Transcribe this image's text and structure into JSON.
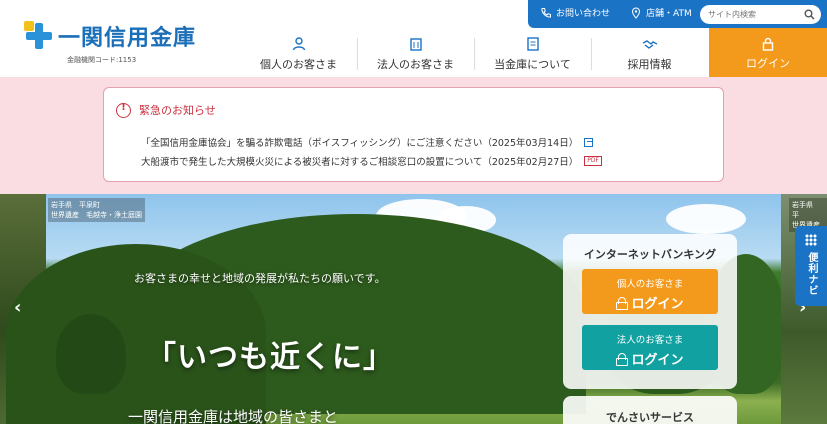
{
  "header": {
    "logo_name": "一関信用金庫",
    "bank_code": "金融機関コード:1153",
    "topbar": {
      "contact": "お問い合わせ",
      "branches": "店舗・ATM",
      "search_placeholder": "サイト内検索"
    },
    "nav": [
      {
        "label": "個人のお客さま",
        "icon": "person-icon"
      },
      {
        "label": "法人のお客さま",
        "icon": "building-icon"
      },
      {
        "label": "当金庫について",
        "icon": "document-icon"
      },
      {
        "label": "採用情報",
        "icon": "handshake-icon"
      }
    ],
    "login": "ログイン"
  },
  "alert": {
    "title": "緊急のお知らせ",
    "items": [
      "「全国信用金庫協会」を騙る詐欺電話（ポイスフィッシング）にご注意ください（2025年03月14日）",
      "大船渡市で発生した大規模火災による被災者に対するご相談窓口の設置について（2025年02月27日）"
    ],
    "pdf_label": "PDF"
  },
  "hero": {
    "caption_left": [
      "岩手県　平泉町",
      "世界遺産　毛越寺・浄土庭園"
    ],
    "caption_right": [
      "岩手県　平",
      "世界遺産"
    ],
    "tagline": "お客さまの幸せと地域の発展が私たちの願いです。",
    "catch": "「いつも近くに」",
    "subcatch": "一関信用金庫は地域の皆さまと",
    "prev": "‹",
    "next": "›"
  },
  "internet_banking": {
    "title": "インターネットバンキング",
    "personal_sub": "個人のお客さま",
    "corporate_sub": "法人のお客さま",
    "login": "ログイン",
    "densai": "でんさいサービス"
  },
  "benri_navi": "便利ナビ",
  "colors": {
    "brand_blue": "#1b73c6",
    "login_orange": "#f39a1c",
    "corporate_teal": "#11a1a1",
    "alert_red": "#c9303e",
    "alert_band": "#f9dde3"
  }
}
